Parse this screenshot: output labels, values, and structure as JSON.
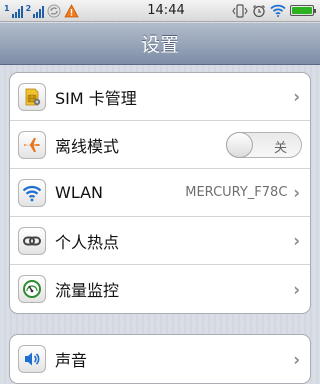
{
  "status_bar": {
    "sim1_label": "1",
    "sim2_label": "2",
    "time": "14:44",
    "icons_left": [
      "signal-sim1-icon",
      "signal-sim2-icon",
      "sync-icon",
      "warning-icon"
    ],
    "icons_right": [
      "vibrate-icon",
      "alarm-icon",
      "wifi-icon",
      "battery-icon"
    ],
    "battery_level": 1.0,
    "battery_color": "#2bb21e"
  },
  "header": {
    "title": "设置"
  },
  "group1": {
    "items": [
      {
        "label": "SIM 卡管理",
        "icon": "sim-card-icon",
        "value": ""
      },
      {
        "label": "离线模式",
        "icon": "airplane-icon",
        "toggle_label": "关",
        "toggle_state": "off"
      },
      {
        "label": "WLAN",
        "icon": "wifi-icon",
        "value": "MERCURY_F78C"
      },
      {
        "label": "个人热点",
        "icon": "link-icon",
        "value": ""
      },
      {
        "label": "流量监控",
        "icon": "gauge-icon",
        "value": ""
      }
    ]
  },
  "group2": {
    "items": [
      {
        "label": "声音",
        "icon": "speaker-icon",
        "value": ""
      }
    ]
  },
  "colors": {
    "accent_blue": "#1e6fd0",
    "title_bar": "#8d9bb0",
    "airplane_orange": "#e8731a",
    "gauge_green": "#2e8b2e"
  }
}
